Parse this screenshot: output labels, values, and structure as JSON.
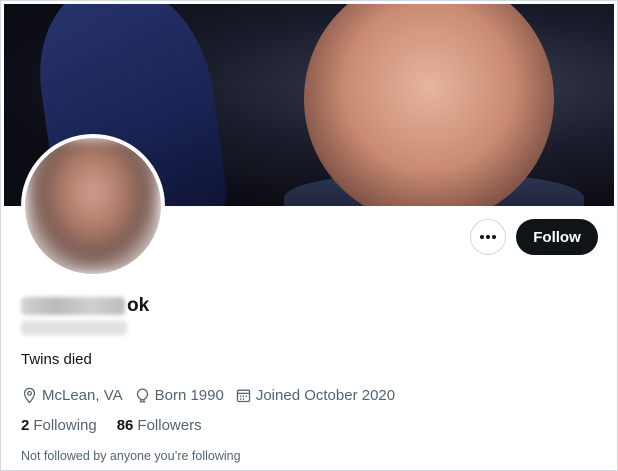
{
  "profile": {
    "name_visible_suffix": "ok",
    "bio": "Twins died",
    "location": "McLean, VA",
    "born": "Born 1990",
    "joined": "Joined October 2020",
    "following_count": "2",
    "following_label": "Following",
    "followers_count": "86",
    "followers_label": "Followers",
    "not_followed_text": "Not followed by anyone you’re following"
  },
  "actions": {
    "more_icon": "more-dots-icon",
    "follow_label": "Follow"
  },
  "icons": {
    "location": "location-pin-icon",
    "born": "balloon-icon",
    "joined": "calendar-icon"
  },
  "colors": {
    "primary_text": "#0f1419",
    "secondary_text": "#536471",
    "follow_button_bg": "#0f1419",
    "border": "#cfd9de"
  }
}
